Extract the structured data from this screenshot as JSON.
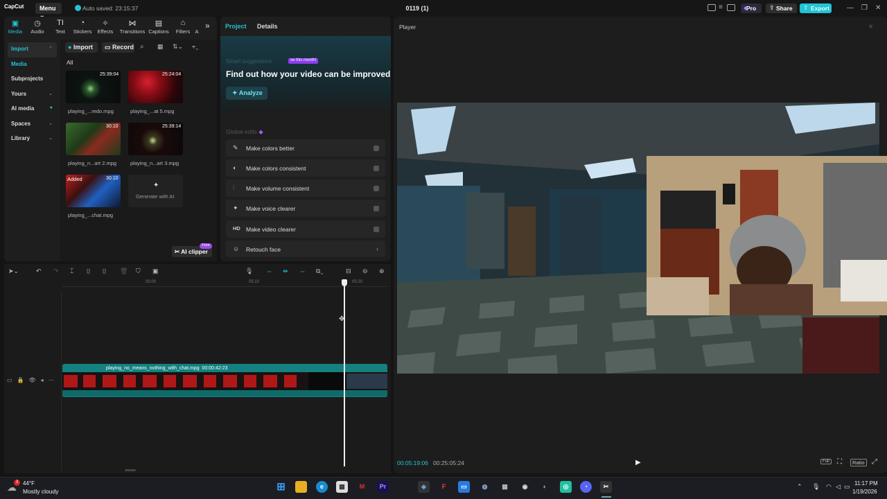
{
  "titlebar": {
    "logo": "CapCut",
    "menu_label": "Menu",
    "autosave": "Auto saved: 23:15:37",
    "project_title": "0119 (1)",
    "pro_label": "Pro",
    "share_label": "Share",
    "export_label": "Export"
  },
  "tool_tabs": [
    "Media",
    "Audio",
    "Text",
    "Stickers",
    "Effects",
    "Transitions",
    "Captions",
    "Filters",
    "A"
  ],
  "side_nav": [
    "Import",
    "Media",
    "Subprojects",
    "Yours",
    "AI media",
    "Spaces",
    "Library"
  ],
  "media": {
    "import_label": "Import",
    "record_label": "Record",
    "filter_all": "All",
    "items": [
      {
        "name": "playing_...redo.mpg",
        "duration": "25:39:04",
        "badge": ""
      },
      {
        "name": "playing_...at 5.mpg",
        "duration": "25:24:04",
        "badge": ""
      },
      {
        "name": "playing_n...art 2.mpg",
        "duration": "30:10",
        "badge": ""
      },
      {
        "name": "playing_n...art 3.mpg",
        "duration": "25:39:14",
        "badge": ""
      },
      {
        "name": "playing_...chat.mpg",
        "duration": "30:10",
        "badge": "Added"
      }
    ],
    "generate_label": "Generate with AI",
    "ai_clipper_label": "AI clipper",
    "free_badge": "Free"
  },
  "project_panel": {
    "tab_project": "Project",
    "tab_details": "Details",
    "smart_suggestions": "Smart suggestions",
    "sugg_badge": "se this month!",
    "improve_title": "Find out how your video can be improved",
    "analyze_label": "Analyze",
    "global_edits": "Global edits",
    "edits": [
      {
        "icon": "✎",
        "label": "Make colors better"
      },
      {
        "icon": "◐",
        "label": "Make colors consistent"
      },
      {
        "icon": "⫶",
        "label": "Make volume consistent"
      },
      {
        "icon": "✦",
        "label": "Make voice clearer"
      },
      {
        "icon": "HD",
        "label": "Make video clearer"
      },
      {
        "icon": "☺",
        "label": "Retouch face"
      }
    ]
  },
  "player": {
    "label": "Player",
    "current_time": "00:05:19:06",
    "total_time": "00:25:05:24",
    "ratio_label": "Ratio"
  },
  "timeline": {
    "ruler": [
      "05:00",
      "05:10",
      "05:20"
    ],
    "clip_name": "playing_no_means_nothing_with_chat.mpg",
    "clip_duration": "00:00:42:23"
  },
  "taskbar": {
    "weather_temp": "44°F",
    "weather_cond": "Mostly cloudy",
    "clock_time": "11:17 PM",
    "clock_date": "1/19/2026",
    "notif_count": "3"
  },
  "colors": {
    "accent": "#25c2d2",
    "clip": "#14807f",
    "purple": "#8b3df0"
  }
}
